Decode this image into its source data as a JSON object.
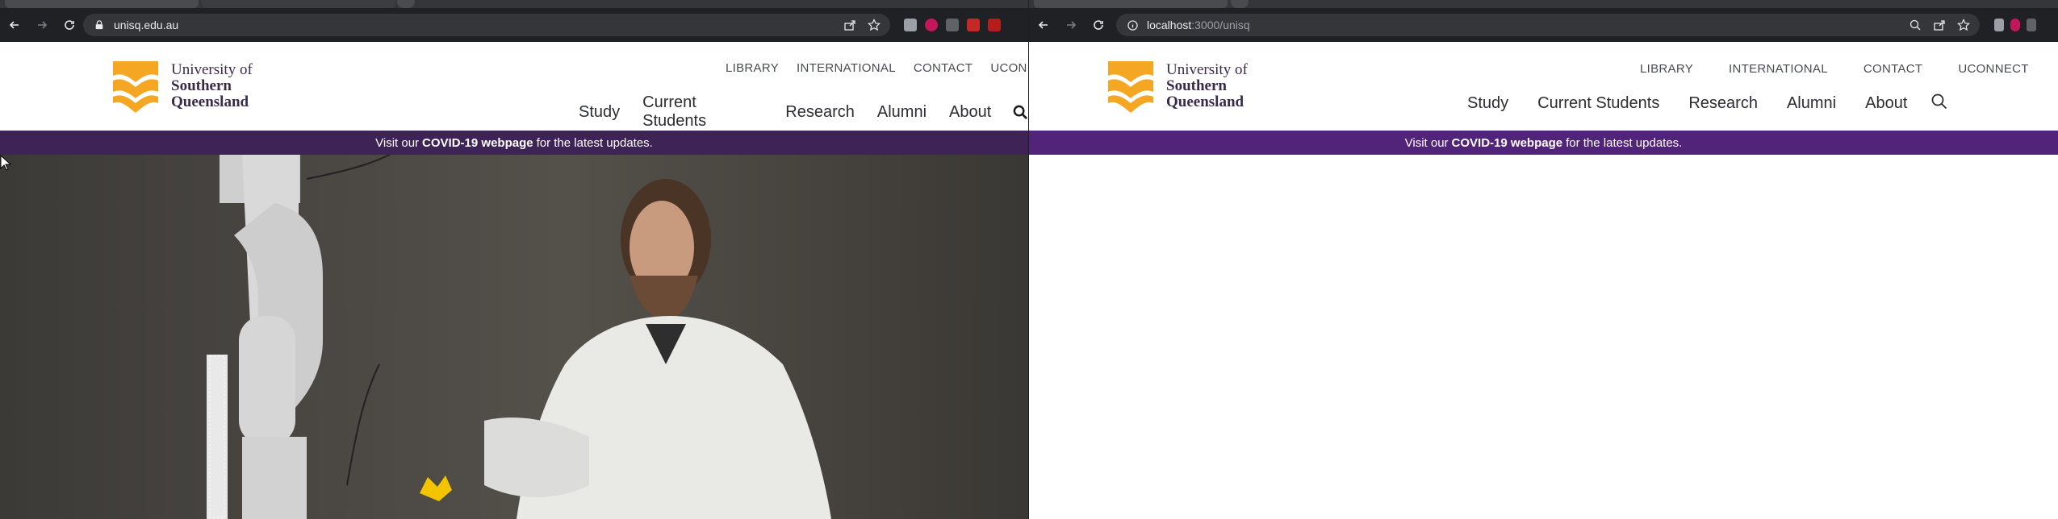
{
  "left_window": {
    "url": "unisq.edu.au",
    "site": {
      "logo": {
        "line1": "University of",
        "line2": "Southern",
        "line3": "Queensland"
      },
      "utility_nav": [
        "LIBRARY",
        "INTERNATIONAL",
        "CONTACT",
        "UCONNECT"
      ],
      "main_nav": [
        "Study",
        "Current Students",
        "Research",
        "Alumni",
        "About"
      ],
      "banner": {
        "prefix": "Visit our",
        "link": "COVID-19 webpage",
        "suffix": "for the latest updates."
      }
    }
  },
  "right_window": {
    "url_host": "localhost",
    "url_rest": ":3000/unisq",
    "site": {
      "logo": {
        "line1": "University of",
        "line2": "Southern",
        "line3": "Queensland"
      },
      "utility_nav": [
        "LIBRARY",
        "INTERNATIONAL",
        "CONTACT",
        "UCONNECT"
      ],
      "main_nav": [
        "Study",
        "Current Students",
        "Research",
        "Alumni",
        "About"
      ],
      "banner": {
        "prefix": "Visit our",
        "link": "COVID-19 webpage",
        "suffix": "for the latest updates."
      }
    }
  },
  "colors": {
    "brand_purple": "#51247a",
    "brand_gold": "#f5a623",
    "chrome_dark": "#202124"
  }
}
